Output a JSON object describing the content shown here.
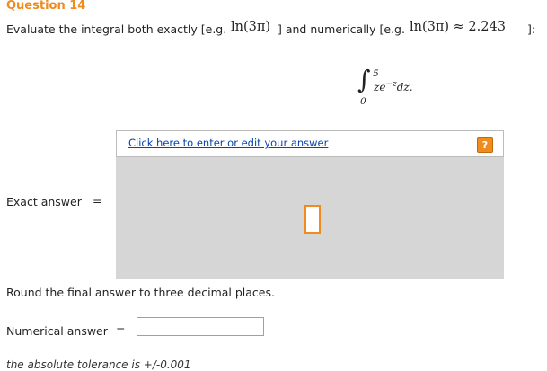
{
  "question": {
    "title": "Question 14",
    "title_color": "#f08c1e",
    "prompt_part1": "Evaluate the integral both exactly [e.g.",
    "example_exact": "ln(3π)",
    "prompt_part2": "] and numerically [e.g.",
    "example_numeric": "ln(3π) ≈ 2.243",
    "prompt_part3": "]:"
  },
  "integral": {
    "upper_limit": "5",
    "lower_limit": "0",
    "integrand": "ze",
    "exponent": "−z",
    "differential": "dz."
  },
  "exact_answer": {
    "label": "Exact answer",
    "equals": "=",
    "editor_link": "Click here to enter or edit your answer",
    "help_icon": "?",
    "editor_background": "#d6d6d6"
  },
  "instructions": "Round the final answer to three decimal places.",
  "numerical_answer": {
    "label": "Numerical answer",
    "equals": "=",
    "value": "",
    "placeholder": ""
  },
  "tolerance": "the absolute tolerance is +/-0.001"
}
